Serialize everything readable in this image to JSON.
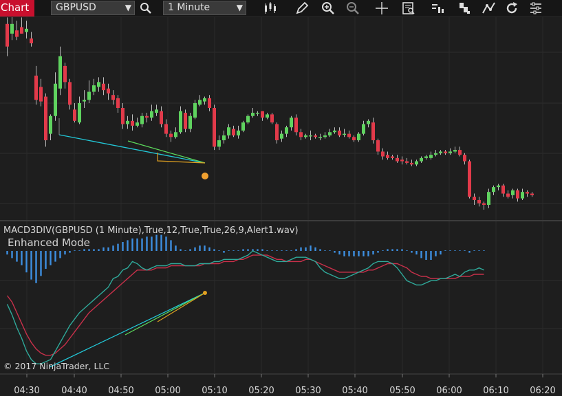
{
  "toolbar": {
    "chart_tab": "Chart",
    "instrument": "GBPUSD",
    "interval": "1 Minute",
    "icons": [
      "search-icon",
      "bar-type-icon",
      "draw-pencil-icon",
      "zoom-in-icon",
      "zoom-out-icon",
      "crosshair-icon",
      "data-box-icon",
      "indicators-icon",
      "strategies-icon",
      "drawing-tools-icon",
      "reload-icon",
      "properties-icon"
    ]
  },
  "indicator": {
    "label": "MACD3DIV(GBPUSD (1 Minute),True,12,True,True,26,9,Alert1.wav)",
    "mode": "Enhanced Mode"
  },
  "copyright": "© 2017 NinjaTrader, LLC",
  "colors": {
    "background": "#1e1e1e",
    "up": "#5fd35f",
    "down": "#e23a4a",
    "histogram": "#3d8fe0",
    "macd_line": "#2fa99a",
    "signal_line": "#c8304a",
    "divergence_line": "#22c8d8",
    "divergence_green": "#5cdc5c",
    "divergence_orange": "#e0a020",
    "signal_dot": "#f0a030"
  },
  "chart_data": {
    "type": "candlestick",
    "x_tick_labels": [
      "04:30",
      "04:40",
      "04:50",
      "05:00",
      "05:10",
      "05:20",
      "05:30",
      "05:40",
      "05:50",
      "06:00",
      "06:10",
      "06:20"
    ],
    "candles": [
      [
        92,
        78,
        96,
        72
      ],
      [
        86,
        92,
        100,
        82
      ],
      [
        88,
        84,
        94,
        82
      ],
      [
        90,
        86,
        96,
        86
      ],
      [
        87,
        89,
        94,
        83
      ],
      [
        83,
        80,
        87,
        78
      ],
      [
        60,
        45,
        66,
        42
      ],
      [
        53,
        44,
        58,
        41
      ],
      [
        47,
        20,
        49,
        16
      ],
      [
        24,
        35,
        36,
        20
      ],
      [
        35,
        55,
        62,
        32
      ],
      [
        52,
        72,
        78,
        48
      ],
      [
        66,
        56,
        68,
        52
      ],
      [
        56,
        42,
        58,
        39
      ],
      [
        39,
        32,
        43,
        31
      ],
      [
        31,
        43,
        47,
        30
      ],
      [
        44,
        45,
        51,
        40
      ],
      [
        45,
        50,
        57,
        43
      ],
      [
        50,
        54,
        58,
        48
      ],
      [
        53,
        56,
        59,
        50
      ],
      [
        55,
        51,
        59,
        48
      ],
      [
        52,
        49,
        55,
        45
      ],
      [
        48,
        45,
        51,
        42
      ],
      [
        46,
        40,
        48,
        37
      ],
      [
        40,
        30,
        43,
        27
      ],
      [
        30,
        32,
        35,
        27
      ],
      [
        32,
        29,
        36,
        26
      ],
      [
        29,
        31,
        34,
        28
      ],
      [
        30,
        35,
        37,
        28
      ],
      [
        35,
        34,
        37,
        31
      ],
      [
        34,
        38,
        42,
        32
      ],
      [
        37,
        39,
        42,
        35
      ],
      [
        38,
        30,
        41,
        28
      ],
      [
        30,
        24,
        33,
        22
      ],
      [
        24,
        22,
        26,
        19
      ],
      [
        22,
        25,
        28,
        21
      ],
      [
        25,
        38,
        41,
        24
      ],
      [
        37,
        27,
        39,
        25
      ],
      [
        27,
        35,
        37,
        25
      ],
      [
        34,
        43,
        45,
        33
      ],
      [
        42,
        45,
        48,
        41
      ],
      [
        44,
        46,
        47,
        42
      ],
      [
        46,
        40,
        48,
        38
      ],
      [
        40,
        16,
        42,
        14
      ],
      [
        16,
        20,
        23,
        14
      ],
      [
        20,
        23,
        26,
        18
      ],
      [
        23,
        28,
        30,
        21
      ],
      [
        27,
        23,
        29,
        22
      ],
      [
        23,
        26,
        29,
        21
      ],
      [
        26,
        31,
        32,
        25
      ],
      [
        31,
        35,
        36,
        30
      ],
      [
        35,
        37,
        40,
        34
      ],
      [
        37,
        37,
        38,
        35
      ],
      [
        38,
        34,
        38,
        32
      ],
      [
        34,
        36,
        37,
        33
      ],
      [
        36,
        31,
        37,
        30
      ],
      [
        30,
        20,
        31,
        18
      ],
      [
        21,
        24,
        26,
        19
      ],
      [
        24,
        28,
        29,
        22
      ],
      [
        28,
        34,
        35,
        26
      ],
      [
        34,
        25,
        36,
        23
      ],
      [
        25,
        22,
        27,
        20
      ],
      [
        22,
        23,
        24,
        21
      ],
      [
        23,
        23,
        26,
        20
      ],
      [
        23,
        22,
        24,
        21
      ],
      [
        22,
        22,
        24,
        20
      ],
      [
        22,
        23,
        25,
        21
      ],
      [
        23,
        25,
        27,
        22
      ],
      [
        25,
        26,
        28,
        24
      ],
      [
        26,
        23,
        28,
        22
      ],
      [
        24,
        24,
        27,
        22
      ],
      [
        24,
        22,
        26,
        21
      ],
      [
        22,
        20,
        23,
        19
      ],
      [
        20,
        24,
        25,
        19
      ],
      [
        24,
        30,
        32,
        23
      ],
      [
        30,
        32,
        33,
        28
      ],
      [
        31,
        20,
        34,
        18
      ],
      [
        20,
        13,
        21,
        11
      ],
      [
        13,
        10,
        15,
        8
      ],
      [
        11,
        9,
        13,
        8
      ],
      [
        10,
        9,
        11,
        8
      ],
      [
        9,
        7,
        11,
        6
      ],
      [
        8,
        7,
        10,
        5
      ],
      [
        7,
        6,
        9,
        5
      ],
      [
        6,
        5,
        8,
        4
      ],
      [
        5,
        7,
        8,
        4
      ],
      [
        7,
        9,
        10,
        6
      ],
      [
        9,
        10,
        11,
        8
      ],
      [
        9,
        11,
        13,
        8
      ],
      [
        11,
        12,
        14,
        10
      ],
      [
        12,
        13,
        14,
        11
      ],
      [
        13,
        12,
        14,
        11
      ],
      [
        12,
        13,
        15,
        11
      ],
      [
        13,
        14,
        16,
        12
      ],
      [
        14,
        11,
        16,
        10
      ],
      [
        11,
        7,
        12,
        5
      ],
      [
        7,
        -15,
        8,
        -16
      ],
      [
        -15,
        -17,
        -13,
        -20
      ],
      [
        -17,
        -19,
        -15,
        -21
      ],
      [
        -19,
        -20,
        -18,
        -23
      ],
      [
        -20,
        -12,
        -10,
        -22
      ],
      [
        -12,
        -9,
        -8,
        -14
      ],
      [
        -9,
        -8,
        -7,
        -11
      ],
      [
        -8,
        -13,
        -7,
        -15
      ],
      [
        -13,
        -15,
        -11,
        -16
      ],
      [
        -14,
        -11,
        -10,
        -16
      ],
      [
        -11,
        -16,
        -10,
        -18
      ],
      [
        -16,
        -12,
        -10,
        -17
      ],
      [
        -12,
        -13,
        -11,
        -15
      ],
      [
        -13,
        -14,
        -12,
        -15
      ]
    ],
    "histogram": [
      -2,
      -4,
      -6,
      -8,
      -12,
      -16,
      -18,
      -14,
      -10,
      -8,
      -6,
      -4,
      -2,
      -1,
      0,
      0,
      1,
      1,
      1,
      1,
      2,
      2,
      3,
      4,
      5,
      6,
      7,
      7,
      7,
      8,
      8,
      9,
      9,
      8,
      6,
      3,
      1,
      0,
      1,
      2,
      3,
      3,
      2,
      1,
      0,
      -1,
      0,
      0,
      0,
      1,
      1,
      1,
      1,
      1,
      0,
      0,
      0,
      0,
      0,
      0,
      1,
      2,
      2,
      3,
      2,
      1,
      0,
      0,
      -1,
      -2,
      -3,
      -3,
      -3,
      -3,
      -3,
      -3,
      -2,
      -1,
      0,
      1,
      1,
      1,
      1,
      0,
      -1,
      -2,
      -4,
      -5,
      -5,
      -3,
      -2,
      0,
      0,
      0,
      0,
      0,
      -1,
      0,
      0,
      0
    ],
    "macd": [
      -4,
      -9,
      -15,
      -20,
      -26,
      -30,
      -32,
      -32,
      -31,
      -30,
      -26,
      -22,
      -18,
      -14,
      -11,
      -8,
      -6,
      -4,
      -2,
      0,
      2,
      4,
      8,
      9,
      12,
      13,
      16,
      15,
      13,
      12,
      13,
      14,
      14,
      14,
      15,
      15,
      15,
      14,
      14,
      14,
      15,
      15,
      15,
      16,
      16,
      17,
      17,
      17,
      17,
      18,
      19,
      21,
      20,
      19,
      18,
      17,
      16,
      16,
      16,
      17,
      18,
      18,
      18,
      17,
      16,
      13,
      11,
      10,
      9,
      8,
      8,
      9,
      10,
      11,
      12,
      13,
      15,
      16,
      16,
      16,
      15,
      13,
      10,
      7,
      6,
      5,
      5,
      6,
      7,
      7,
      8,
      8,
      9,
      10,
      9,
      11,
      12,
      12,
      13,
      12
    ],
    "signal": [
      0,
      -3,
      -8,
      -13,
      -18,
      -22,
      -25,
      -27,
      -28,
      -28,
      -27,
      -25,
      -23,
      -20,
      -17,
      -14,
      -11,
      -8,
      -6,
      -4,
      -2,
      0,
      2,
      4,
      6,
      8,
      10,
      12,
      12,
      12,
      12,
      13,
      13,
      13,
      14,
      14,
      14,
      14,
      14,
      14,
      14,
      15,
      15,
      15,
      15,
      16,
      16,
      16,
      17,
      17,
      18,
      19,
      19,
      19,
      19,
      18,
      17,
      17,
      16,
      16,
      16,
      16,
      17,
      17,
      16,
      15,
      14,
      13,
      12,
      11,
      11,
      11,
      11,
      11,
      11,
      12,
      12,
      13,
      14,
      15,
      15,
      15,
      14,
      13,
      11,
      10,
      9,
      9,
      8,
      8,
      8,
      8,
      8,
      8,
      9,
      9,
      9,
      10,
      10,
      10
    ]
  }
}
